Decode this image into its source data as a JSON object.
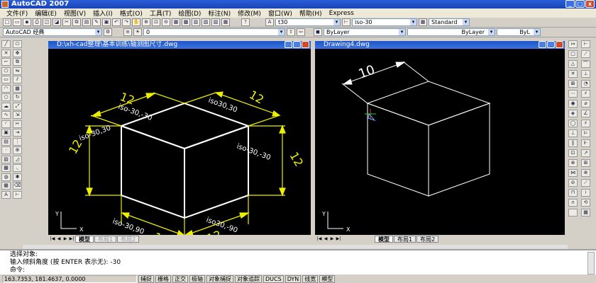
{
  "app": {
    "title": "AutoCAD 2007"
  },
  "menu": [
    "文件(F)",
    "编辑(E)",
    "视图(V)",
    "插入(I)",
    "格式(O)",
    "工具(T)",
    "绘图(D)",
    "标注(N)",
    "修改(M)",
    "窗口(W)",
    "帮助(H)",
    "Express"
  ],
  "toolbar": {
    "workspace": "AutoCAD 经典",
    "layer": "0",
    "text_style": "t30",
    "dim_style": "iso-30",
    "table_style": "Standard",
    "color": "ByLayer",
    "linetype": "ByLayer",
    "lineweight": "ByL"
  },
  "window_left": {
    "title": "D:\\xh-cad整理\\基本训练\\轴测图尺寸.dwg",
    "labels": {
      "dim_12": "12",
      "style_a": "iso-30,-30",
      "style_b": "iso30,30",
      "style_c": "iso-30,30",
      "style_d": "iso-30,-30",
      "style_e": "iso-30,90",
      "style_f": "iso30,-90",
      "axis_x": "X",
      "axis_y": "Y"
    },
    "tabs": [
      "模型",
      "布局1",
      "布局2"
    ]
  },
  "window_right": {
    "title": "Drawing4.dwg",
    "dim": "10",
    "axis_x": "X",
    "axis_y": "Y",
    "tabs": [
      "模型",
      "布局1",
      "布局2"
    ]
  },
  "command": {
    "line1": "选择对象:",
    "line2": "输入倾斜角度 (按 ENTER 表示无): -30",
    "prompt": "命令:"
  },
  "status": {
    "coords": "163.7353, 181.4637, 0.0000",
    "buttons": [
      "捕捉",
      "栅格",
      "正交",
      "极轴",
      "对象捕捉",
      "对象追踪",
      "DUCS",
      "DYN",
      "线宽",
      "模型"
    ]
  }
}
